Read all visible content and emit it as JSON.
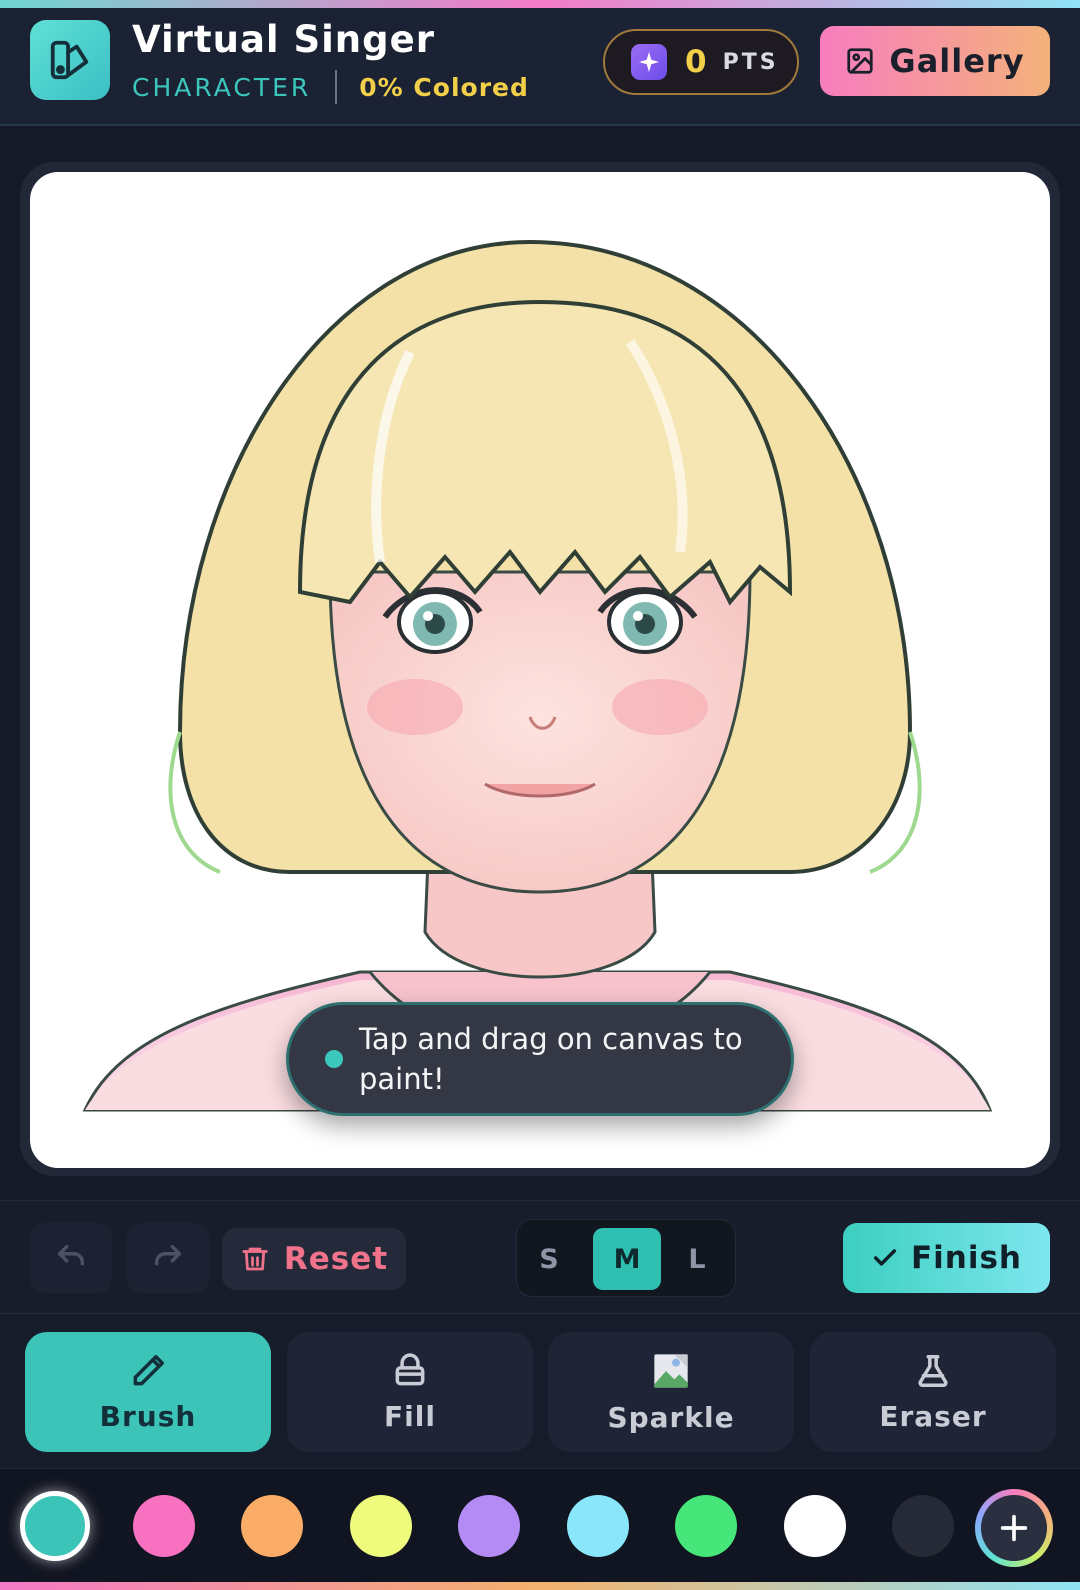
{
  "header": {
    "title": "Virtual Singer",
    "category": "CHARACTER",
    "progress": "0% Colored",
    "points_value": "0",
    "points_unit": "PTS",
    "gallery_label": "Gallery"
  },
  "canvas": {
    "toast": "Tap and drag on canvas to paint!"
  },
  "toolbar": {
    "undo_icon": "undo-icon",
    "redo_icon": "redo-icon",
    "reset_label": "Reset",
    "sizes": [
      "S",
      "M",
      "L"
    ],
    "selected_size": "M",
    "finish_label": "Finish"
  },
  "tools": {
    "items": [
      {
        "label": "Brush",
        "icon": "pencil-icon"
      },
      {
        "label": "Fill",
        "icon": "bucket-icon"
      },
      {
        "label": "Sparkle",
        "icon": "broken-image-icon"
      },
      {
        "label": "Eraser",
        "icon": "flask-icon"
      }
    ],
    "selected": "Brush"
  },
  "palette": {
    "colors": [
      "#3cc4b8",
      "#f771c0",
      "#fbac67",
      "#eefb7d",
      "#b48af5",
      "#8ae6fb",
      "#47e67b",
      "#ffffff",
      "#262a36"
    ],
    "selected_index": 0,
    "add_icon": "plus-icon"
  },
  "colors": {
    "accent": "#3cc4b8",
    "gold": "#f2cf49",
    "reset": "#f0738b"
  }
}
